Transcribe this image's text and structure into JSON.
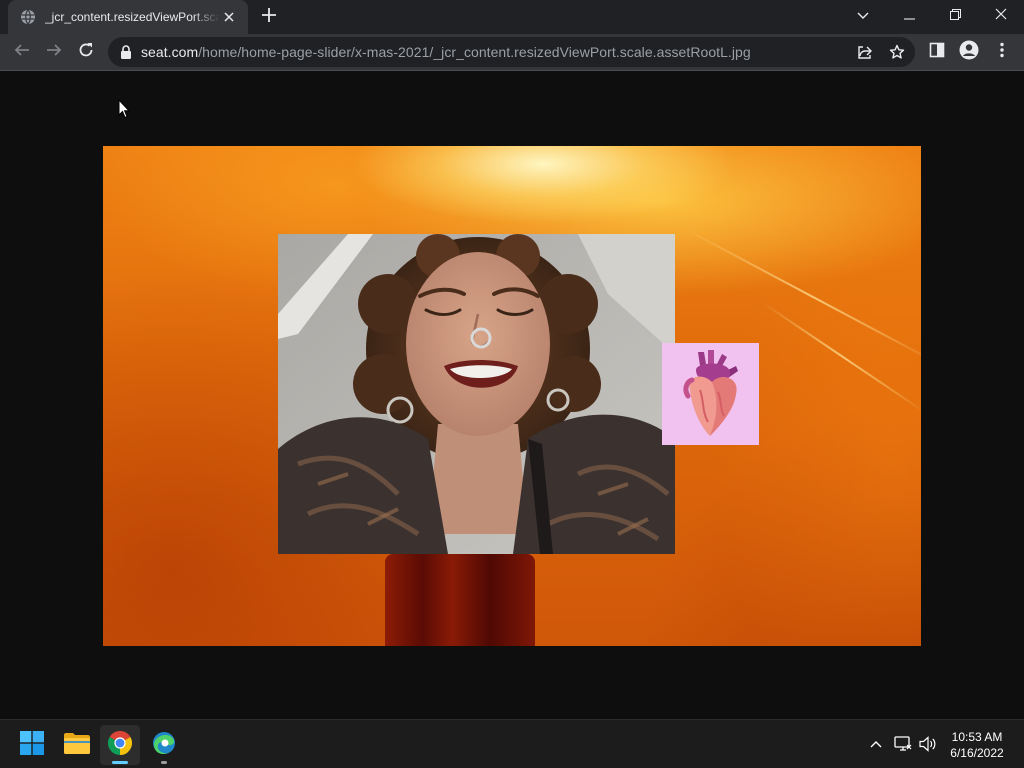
{
  "browser": {
    "tab": {
      "title": "_jcr_content.resizedViewPort.scale.assetRootL.jpg",
      "favicon": "globe-icon",
      "close_icon": "close-icon"
    },
    "new_tab_icon": "plus-icon",
    "window_controls": [
      "chevron-down-icon",
      "minimize-icon",
      "restore-icon",
      "close-icon"
    ],
    "toolbar": {
      "back_icon": "arrow-left-icon",
      "forward_icon": "arrow-right-icon",
      "reload_icon": "reload-icon",
      "lock_icon": "lock-icon",
      "url_host": "seat.com",
      "url_path": "/home/home-page-slider/x-mas-2021/_jcr_content.resizedViewPort.scale.assetRootL.jpg",
      "right_icons": [
        "share-icon",
        "star-icon",
        "side-panel-icon",
        "profile-icon",
        "kebab-menu-icon"
      ]
    }
  },
  "viewport": {
    "background": "#0e0e0e",
    "image": {
      "file": "_jcr_content.resizedViewPort.scale.assetRootL.jpg",
      "background_color": "#e8740f",
      "photo": "smiling-woman-curly-hair-nose-ring",
      "sticker": "anatomical-heart",
      "sticker_background": "#f1c2ef"
    }
  },
  "taskbar": {
    "apps": [
      {
        "name": "start-button",
        "icon": "windows-logo-icon",
        "active": false
      },
      {
        "name": "file-explorer",
        "icon": "folder-icon",
        "active": false
      },
      {
        "name": "google-chrome",
        "icon": "chrome-icon",
        "active": true
      },
      {
        "name": "microsoft-edge",
        "icon": "edge-icon",
        "active": false
      }
    ],
    "tray_icons": [
      "chevron-up-icon",
      "network-icon",
      "volume-icon"
    ],
    "clock": {
      "time": "10:53 AM",
      "date": "6/16/2022"
    }
  }
}
